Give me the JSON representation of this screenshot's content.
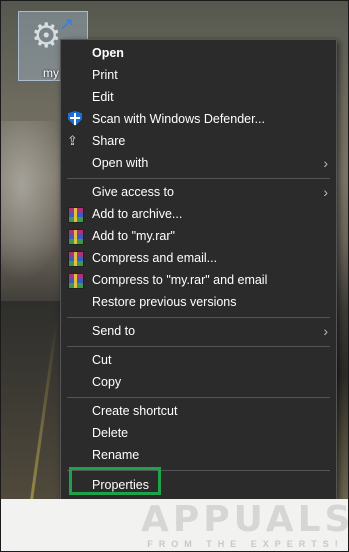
{
  "desktop": {
    "icon_label": "my"
  },
  "menu": {
    "items": [
      {
        "label": "Open",
        "bold": true
      },
      {
        "label": "Print"
      },
      {
        "label": "Edit"
      },
      {
        "label": "Scan with Windows Defender...",
        "icon": "windows-defender-shield-icon"
      },
      {
        "label": "Share",
        "icon": "share-icon"
      },
      {
        "label": "Open with",
        "submenu": true
      },
      {
        "label": "Give access to",
        "submenu": true
      },
      {
        "label": "Add to archive...",
        "icon": "winrar-icon"
      },
      {
        "label": "Add to \"my.rar\"",
        "icon": "winrar-icon"
      },
      {
        "label": "Compress and email...",
        "icon": "winrar-icon"
      },
      {
        "label": "Compress to \"my.rar\" and email",
        "icon": "winrar-icon"
      },
      {
        "label": "Restore previous versions"
      },
      {
        "label": "Send to",
        "submenu": true
      },
      {
        "label": "Cut"
      },
      {
        "label": "Copy"
      },
      {
        "label": "Create shortcut"
      },
      {
        "label": "Delete"
      },
      {
        "label": "Rename"
      },
      {
        "label": "Properties"
      }
    ],
    "submenu_glyph": "›",
    "highlight_color": "#1fa34a"
  },
  "watermark": {
    "word": "APPUALS",
    "tagline": "FROM THE EXPERTS!"
  }
}
